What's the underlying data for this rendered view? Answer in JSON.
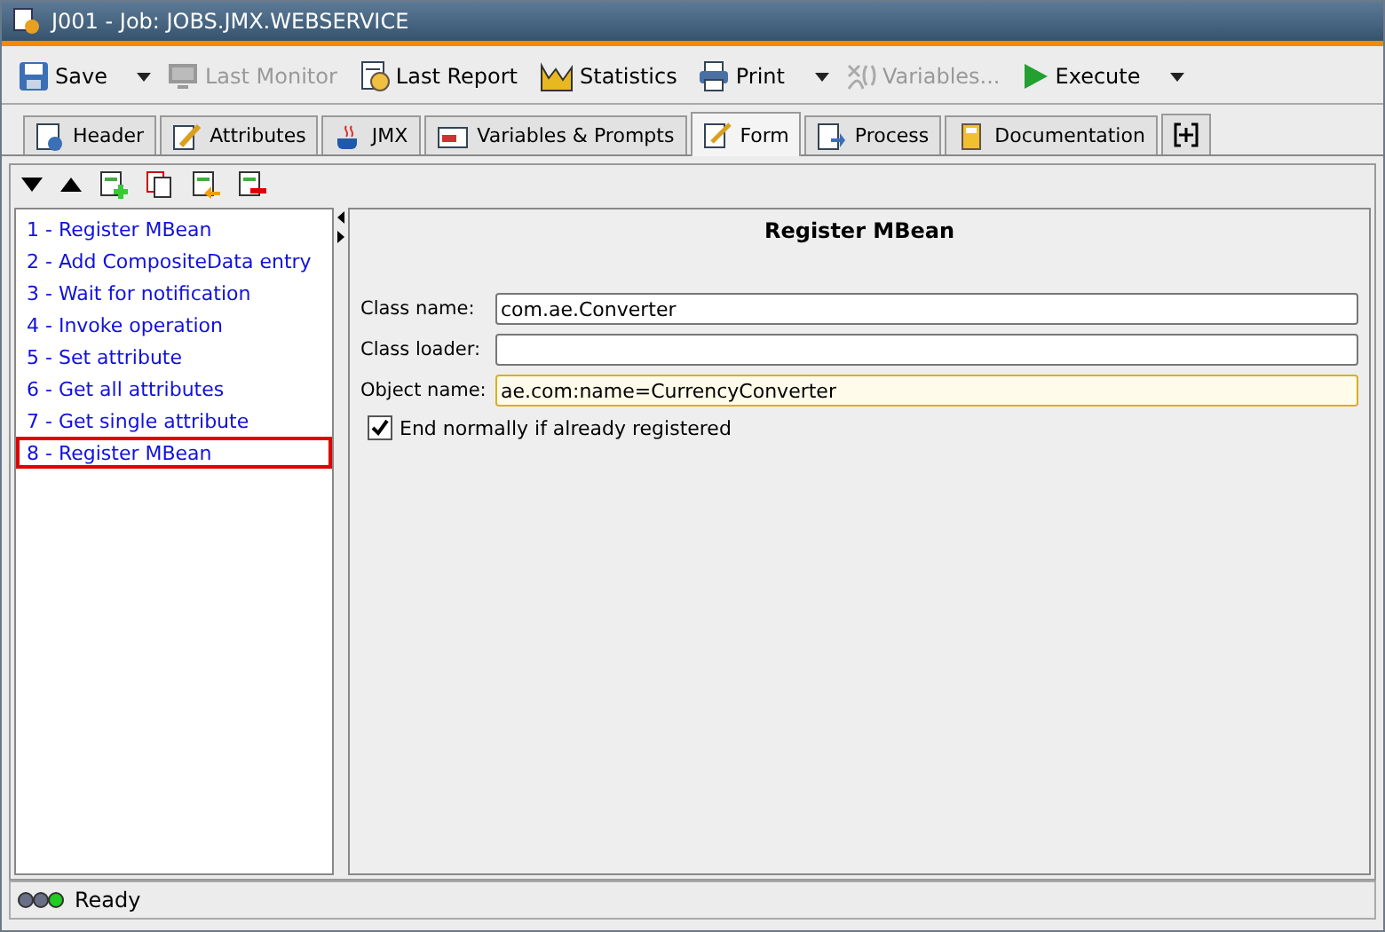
{
  "window": {
    "title": "J001 - Job: JOBS.JMX.WEBSERVICE"
  },
  "toolbar": [
    {
      "label": "Save",
      "disabled": false,
      "dropdown": true
    },
    {
      "label": "Last Monitor",
      "disabled": true,
      "dropdown": false
    },
    {
      "label": "Last Report",
      "disabled": false,
      "dropdown": false
    },
    {
      "label": "Statistics",
      "disabled": false,
      "dropdown": false
    },
    {
      "label": "Print",
      "disabled": false,
      "dropdown": true
    },
    {
      "label": "Variables...",
      "disabled": true,
      "dropdown": false
    },
    {
      "label": "Execute",
      "disabled": false,
      "dropdown": true
    }
  ],
  "tabs": [
    {
      "label": "Header",
      "selected": false
    },
    {
      "label": "Attributes",
      "selected": false
    },
    {
      "label": "JMX",
      "selected": false
    },
    {
      "label": "Variables & Prompts",
      "selected": false
    },
    {
      "label": "Form",
      "selected": true
    },
    {
      "label": "Process",
      "selected": false
    },
    {
      "label": "Documentation",
      "selected": false
    }
  ],
  "steps": [
    {
      "label": "1 - Register MBean",
      "selected": false
    },
    {
      "label": "2 - Add CompositeData entry",
      "selected": false
    },
    {
      "label": "3 - Wait for notification",
      "selected": false
    },
    {
      "label": "4 - Invoke operation",
      "selected": false
    },
    {
      "label": "5 - Set attribute",
      "selected": false
    },
    {
      "label": "6 - Get all attributes",
      "selected": false
    },
    {
      "label": "7 - Get single attribute",
      "selected": false
    },
    {
      "label": "8 - Register MBean",
      "selected": true
    }
  ],
  "form": {
    "title": "Register MBean",
    "fields": [
      {
        "label": "Class name:",
        "value": "com.ae.Converter",
        "focused": false
      },
      {
        "label": "Class loader:",
        "focused": false
      },
      {
        "label": "Object name:",
        "value": "ae.com:name=CurrencyConverter",
        "focused": true
      }
    ],
    "checkbox": {
      "label": "End normally if already registered",
      "checked": true
    }
  },
  "status_bar": {
    "text": "Ready"
  }
}
